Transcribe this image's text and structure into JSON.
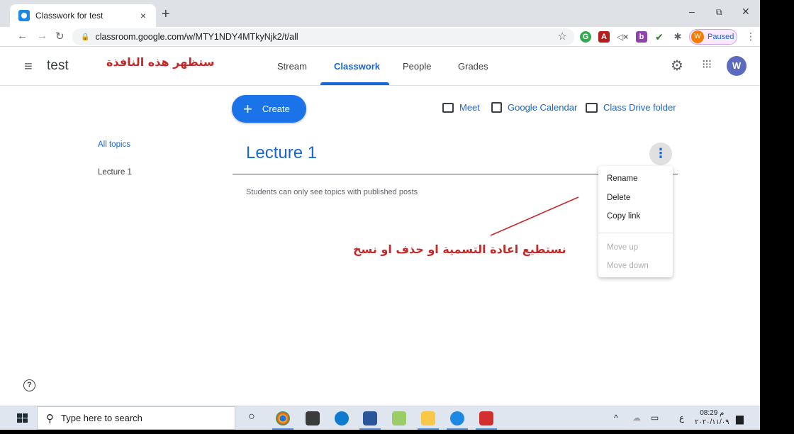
{
  "browser": {
    "tab_title": "Classwork for test",
    "tab_close": "×",
    "new_tab": "+",
    "minimize": "–",
    "restore": "⧉",
    "close": "✕",
    "url": "classroom.google.com/w/MTY1NDY4MTkyNjk2/t/all",
    "profile_initial": "W",
    "profile_status": "Paused"
  },
  "header": {
    "class_name": "test",
    "annotation": "ستظهر هذه النافذة",
    "tabs": [
      {
        "label": "Stream"
      },
      {
        "label": "Classwork"
      },
      {
        "label": "People"
      },
      {
        "label": "Grades"
      }
    ],
    "user_initial": "W"
  },
  "main": {
    "create_label": "Create",
    "quick_links": [
      {
        "label": "Meet",
        "icon": "video-camera-icon"
      },
      {
        "label": "Google Calendar",
        "icon": "calendar-icon"
      },
      {
        "label": "Class Drive folder",
        "icon": "folder-icon"
      }
    ],
    "side_topics": [
      {
        "label": "All topics"
      },
      {
        "label": "Lecture 1"
      }
    ],
    "topic_title": "Lecture 1",
    "topic_note": "Students can only see topics with published posts",
    "menu": {
      "items": [
        "Rename",
        "Delete",
        "Copy link"
      ],
      "disabled_items": [
        "Move up",
        "Move down"
      ]
    },
    "annotation": "نستطيع اعادة التسمية او حذف او نسخ"
  },
  "taskbar": {
    "search_placeholder": "Type here to search",
    "time": "08:29 م",
    "date": "٢٠٢٠/١١/٠٩",
    "lang": "ع"
  }
}
